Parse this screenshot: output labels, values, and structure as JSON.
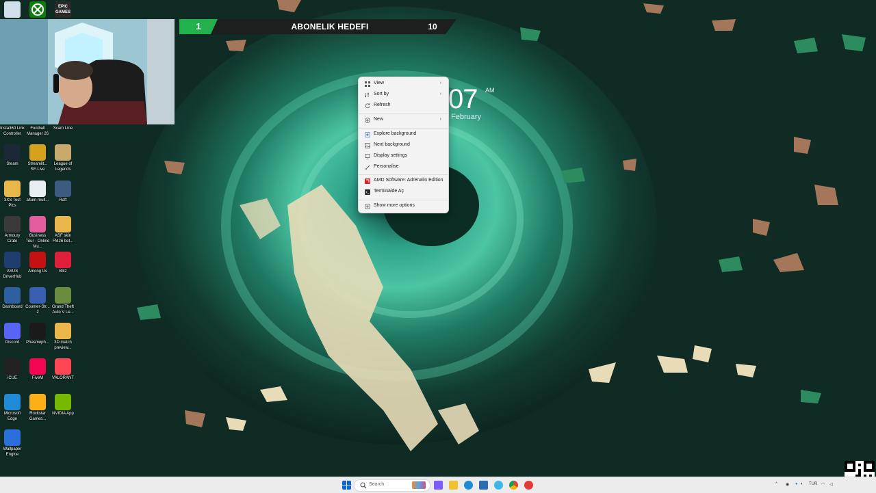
{
  "stream_overlay": {
    "current_count": "1",
    "goal_title": "ABONELIK HEDEFI",
    "goal_target": "10"
  },
  "clock": {
    "time": "07",
    "ampm": "AM",
    "date": "February"
  },
  "context_menu": {
    "items": [
      {
        "label": "View",
        "icon": "grid-icon",
        "has_submenu": true
      },
      {
        "label": "Sort by",
        "icon": "sort-icon",
        "has_submenu": true
      },
      {
        "label": "Refresh",
        "icon": "refresh-icon",
        "has_submenu": false
      },
      {
        "label": "New",
        "icon": "plus-circle-icon",
        "has_submenu": true
      },
      {
        "label": "Explore background",
        "icon": "explore-icon",
        "has_submenu": false
      },
      {
        "label": "Next background",
        "icon": "image-icon",
        "has_submenu": false
      },
      {
        "label": "Display settings",
        "icon": "display-icon",
        "has_submenu": false
      },
      {
        "label": "Personalise",
        "icon": "brush-icon",
        "has_submenu": false
      },
      {
        "label": "AMD Software: Adrenalin Edition",
        "icon": "amd-icon",
        "has_submenu": false
      },
      {
        "label": "Terminalde Aç",
        "icon": "terminal-icon",
        "has_submenu": false
      },
      {
        "label": "Show more options",
        "icon": "more-options-icon",
        "has_submenu": false
      }
    ]
  },
  "desktop_icons": [
    {
      "label": "Insta360 Link Controller",
      "color": "#2b2b2b"
    },
    {
      "label": "Football Manager 26",
      "color": "#1b2a5c"
    },
    {
      "label": "Scam Line",
      "color": "#3a3a3a"
    },
    {
      "label": "Steam",
      "color": "#1b2838"
    },
    {
      "label": "Streamlit... SE.Live",
      "color": "#d6a21e"
    },
    {
      "label": "League of Legends",
      "color": "#c8aa6e"
    },
    {
      "label": "3XS Test Pics",
      "color": "#e8b64a"
    },
    {
      "label": "altum-mult...",
      "color": "#e9eef2"
    },
    {
      "label": "Raft",
      "color": "#3d5a80"
    },
    {
      "label": "Armoury Crate",
      "color": "#3a3a3a"
    },
    {
      "label": "Business Tour - Online Mu...",
      "color": "#e25c9e"
    },
    {
      "label": "ASF skin FM26 bet...",
      "color": "#e8b64a"
    },
    {
      "label": "ASUS DriverHub",
      "color": "#1f3d6e"
    },
    {
      "label": "Among Us",
      "color": "#c51111"
    },
    {
      "label": "Blitz",
      "color": "#e0203a"
    },
    {
      "label": "Dashboard",
      "color": "#2f5f9e"
    },
    {
      "label": "Counter-Str... 2",
      "color": "#3a5fb0"
    },
    {
      "label": "Grand Theft Auto V Le...",
      "color": "#6a8c3e"
    },
    {
      "label": "Discord",
      "color": "#5865f2"
    },
    {
      "label": "Phasmoph...",
      "color": "#1a1a1a"
    },
    {
      "label": "3D match preview...",
      "color": "#e8b64a"
    },
    {
      "label": "iCUE",
      "color": "#222"
    },
    {
      "label": "FiveM",
      "color": "#f40552"
    },
    {
      "label": "VALORANT",
      "color": "#ff4655"
    },
    {
      "label": "Microsoft Edge",
      "color": "#1f8ad6"
    },
    {
      "label": "Rockstar Games...",
      "color": "#fcaf17"
    },
    {
      "label": "NVIDIA App",
      "color": "#76b900"
    },
    {
      "label": "Wallpaper Engine",
      "color": "#2a6fdb"
    }
  ],
  "top_icons": [
    {
      "label": "Recycle Bin",
      "color": "#d0dfe9"
    },
    {
      "label": "Xbox",
      "color": "#107c10"
    },
    {
      "label": "EPIC GAMES",
      "color": "#2a2a2a"
    }
  ],
  "taskbar": {
    "search_placeholder": "Search",
    "tray_lang": "TUR",
    "apps": [
      {
        "name": "start-icon",
        "color": "#0a64d8"
      },
      {
        "name": "widgets-icon",
        "color": "#7a5cff"
      },
      {
        "name": "copilot-icon",
        "color": "#3fb6e8"
      },
      {
        "name": "file-explorer-icon",
        "color": "#f2c12e"
      },
      {
        "name": "edge-icon",
        "color": "#1f8ad6"
      },
      {
        "name": "store-icon",
        "color": "#2b6cb0"
      },
      {
        "name": "chrome-icon",
        "color": "#db4437"
      },
      {
        "name": "chrome-profile-icon",
        "color": "#f4b400"
      },
      {
        "name": "record-icon",
        "color": "#e53935"
      }
    ]
  }
}
